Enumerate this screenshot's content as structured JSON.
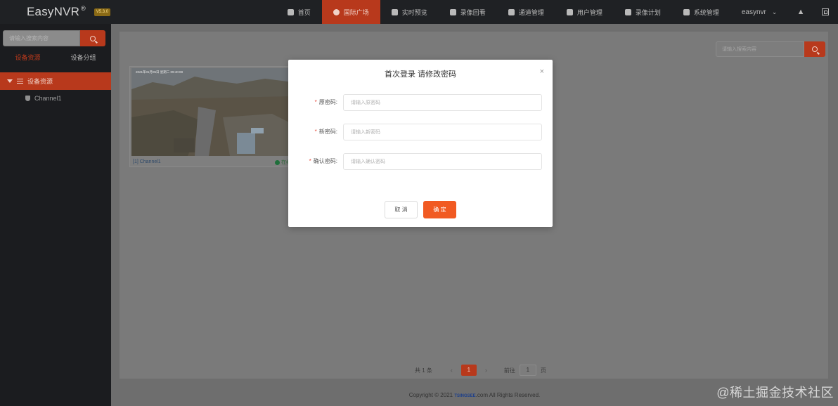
{
  "brand": {
    "name": "EasyNVR",
    "reg": "®",
    "badge": "V5.3.0"
  },
  "nav": {
    "items": [
      {
        "label": "首页",
        "icon": "dashboard-icon",
        "active": false
      },
      {
        "label": "国际广场",
        "icon": "play-circle-icon",
        "active": true
      },
      {
        "label": "实时预览",
        "icon": "video-camera-icon",
        "active": false
      },
      {
        "label": "录像回看",
        "icon": "playback-icon",
        "active": false
      },
      {
        "label": "通道管理",
        "icon": "book-icon",
        "active": false
      },
      {
        "label": "用户管理",
        "icon": "user-icon",
        "active": false
      },
      {
        "label": "录像计划",
        "icon": "clock-icon",
        "active": false
      },
      {
        "label": "系统管理",
        "icon": "gear-icon",
        "active": false
      }
    ],
    "user": "easynvr"
  },
  "sidebar": {
    "search_placeholder": "请输入搜索内容",
    "tabs": [
      "设备资源",
      "设备分组"
    ],
    "tree_root": "设备资源",
    "tree_child": "Channel1"
  },
  "main": {
    "search_placeholder": "请输入搜索内容",
    "camera": {
      "overlay": "2021年01月05日 星期二 09:40:08",
      "name": "[1] Channel1",
      "status": "在线"
    },
    "pager": {
      "total": "共 1 条",
      "page": "1",
      "goto_label": "前往",
      "goto_value": "1",
      "page_suffix": "页"
    },
    "footer": {
      "prefix": "Copyright © 2021",
      "logo": "TSINGSEE",
      "suffix": ".com All Rights Reserved."
    }
  },
  "modal": {
    "title": "首次登录 请修改密码",
    "close": "×",
    "fields": [
      {
        "label": "原密码:",
        "placeholder": "请输入原密码"
      },
      {
        "label": "新密码:",
        "placeholder": "请输入新密码"
      },
      {
        "label": "确认密码:",
        "placeholder": "请输入确认密码"
      }
    ],
    "cancel_label": "取 消",
    "ok_label": "确 定"
  },
  "watermark": "@稀土掘金技术社区",
  "colors": {
    "accent": "#b8391c",
    "primary_button": "#f15a22",
    "topbar": "#1f2124",
    "sidebar": "#1b1c1f"
  }
}
